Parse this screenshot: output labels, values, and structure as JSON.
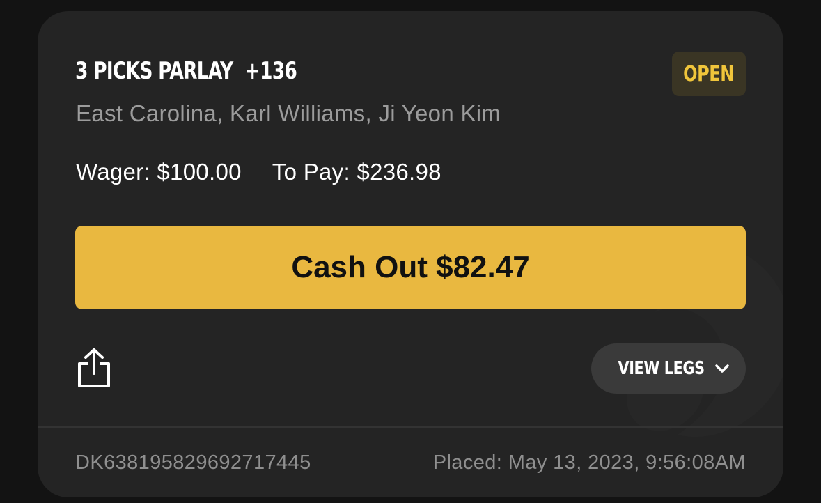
{
  "bet": {
    "type_label": "3 PICKS PARLAY",
    "odds": "+136",
    "status": "OPEN",
    "picks": "East Carolina, Karl Williams, Ji Yeon Kim",
    "wager_label": "Wager: $100.00",
    "to_pay_label": "To Pay: $236.98"
  },
  "actions": {
    "cash_out_label": "Cash Out $82.47",
    "view_legs_label": "VIEW LEGS"
  },
  "footer": {
    "bet_id": "DK638195829692717445",
    "placed": "Placed: May 13, 2023, 9:56:08AM"
  },
  "icons": {
    "share": "share-icon",
    "chevron": "chevron-down-icon"
  },
  "colors": {
    "accent": "#e9b840",
    "status": "#f0c53b",
    "card_bg": "#242424"
  }
}
